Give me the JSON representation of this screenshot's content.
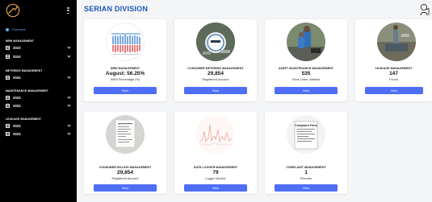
{
  "sidebar": {
    "overview_label": "Overview",
    "sections": [
      {
        "title": "NRW MANAGEMENT",
        "years": [
          "2023",
          "2024"
        ]
      },
      {
        "title": "METERING MANAGEMENT",
        "years": [
          "2024"
        ]
      },
      {
        "title": "MAINTENANCE MANAGEMENT",
        "years": [
          "2023",
          "2024"
        ]
      },
      {
        "title": "LEAKAGE MANAGEMENT",
        "years": [
          "2023",
          "2024"
        ]
      }
    ]
  },
  "header": {
    "title": "SERIAN DIVISION"
  },
  "cards": [
    {
      "title": "NRW MANAGEMENT",
      "value": "August: 56.25%",
      "sub": "NRW Percentage (%)",
      "button": "View"
    },
    {
      "title": "CONSUMER METERING MANAGEMENT",
      "value": "29,854",
      "sub": "Registered Account",
      "button": "View"
    },
    {
      "title": "ASSET MAINTENANCE MANAGEMENT",
      "value": "535",
      "sub": "Work Order Initiated",
      "button": "View"
    },
    {
      "title": "LEAKAGE MANAGEMENT",
      "value": "147",
      "sub": "Found",
      "button": "View"
    },
    {
      "title": "CONSUMER BILLING MANAGEMENT",
      "value": "29,854",
      "sub": "Registered Account",
      "button": "View"
    },
    {
      "title": "DATA LOGGER MANAGEMENT",
      "value": "79",
      "sub": "Logger Monitor",
      "button": "View"
    },
    {
      "title": "COMPLAINT MANAGEMENT",
      "value": "1",
      "sub": "Records",
      "button": "View"
    }
  ],
  "colors": {
    "accent": "#1a56b7",
    "button": "#4f6ef7",
    "sidebar_bg": "#000000",
    "overview": "#5fb0ff"
  },
  "thumbnail_text": {
    "complaint_form": "Complaint Form"
  }
}
